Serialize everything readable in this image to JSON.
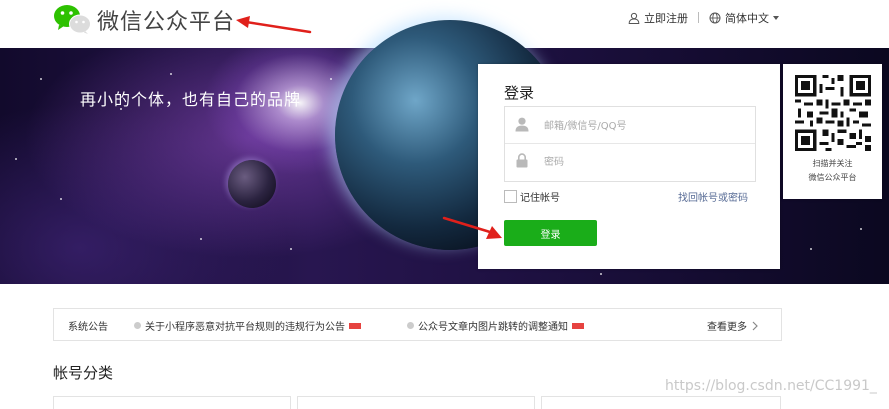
{
  "header": {
    "brand": "微信公众平台",
    "register_label": "立即注册",
    "language_label": "简体中文"
  },
  "banner": {
    "slogan": "再小的个体，也有自己的品牌"
  },
  "login": {
    "title": "登录",
    "account_placeholder": "邮箱/微信号/QQ号",
    "password_placeholder": "密码",
    "remember_label": "记住帐号",
    "forgot_label": "找回帐号或密码",
    "submit_label": "登录"
  },
  "qr": {
    "line1": "扫描并关注",
    "line2": "微信公众平台"
  },
  "notices": {
    "label": "系统公告",
    "items": [
      {
        "text": "关于小程序恶意对抗平台规则的违规行为公告"
      },
      {
        "text": "公众号文章内图片跳转的调整通知"
      }
    ],
    "view_more": "查看更多"
  },
  "section": {
    "title": "帐号分类"
  },
  "watermark": "https://blog.csdn.net/CC1991_",
  "colors": {
    "primary_green": "#1aad19",
    "link_blue": "#576b95",
    "badge_red": "#e64340",
    "annotation_red": "#e0201b"
  }
}
